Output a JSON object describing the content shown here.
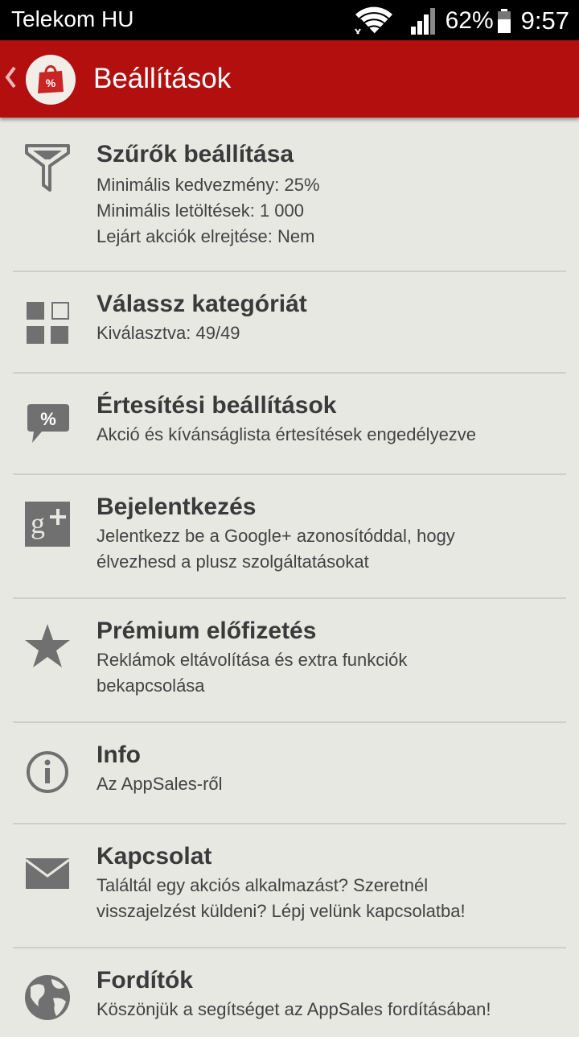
{
  "status_bar": {
    "carrier": "Telekom HU",
    "battery_percent": "62%",
    "time": "9:57",
    "wifi_icon": "wifi-icon",
    "signal_icon": "signal-icon",
    "battery_icon": "battery-icon"
  },
  "app_bar": {
    "title": "Beállítások",
    "back_icon": "chevron-left-icon",
    "logo_icon": "shopping-bag-percent-icon",
    "background_color": "#b30f0f"
  },
  "settings": {
    "filters": {
      "title": "Szűrők beállítása",
      "line1": "Minimális kedvezmény: 25%",
      "line2": "Minimális letöltések: 1 000",
      "line3": "Lejárt akciók elrejtése: Nem",
      "icon": "filter-funnel-icon"
    },
    "categories": {
      "title": "Válassz kategóriát",
      "line1": "Kiválasztva: 49/49",
      "icon": "category-grid-icon"
    },
    "notifications": {
      "title": "Értesítési beállítások",
      "line1": "Akció és kívánságlista értesítések engedélyezve",
      "icon": "percent-speech-bubble-icon"
    },
    "login": {
      "title": "Bejelentkezés",
      "line1": "Jelentkezz be a Google+ azonosítóddal, hogy",
      "line2": "élvezhesd a plusz szolgáltatásokat",
      "icon": "google-plus-icon"
    },
    "premium": {
      "title": "Prémium előfizetés",
      "line1": "Reklámok eltávolítása és extra funkciók",
      "line2": "bekapcsolása",
      "icon": "star-icon"
    },
    "info": {
      "title": "Info",
      "line1": "Az AppSales-ről",
      "icon": "info-icon"
    },
    "contact": {
      "title": "Kapcsolat",
      "line1": "Találtál egy akciós alkalmazást? Szeretnél",
      "line2": "visszajelzést küldeni? Lépj velünk kapcsolatba!",
      "icon": "mail-envelope-icon"
    },
    "translators": {
      "title": "Fordítók",
      "line1": "Köszönjük a segítséget az AppSales fordításában!",
      "icon": "globe-icon"
    }
  }
}
